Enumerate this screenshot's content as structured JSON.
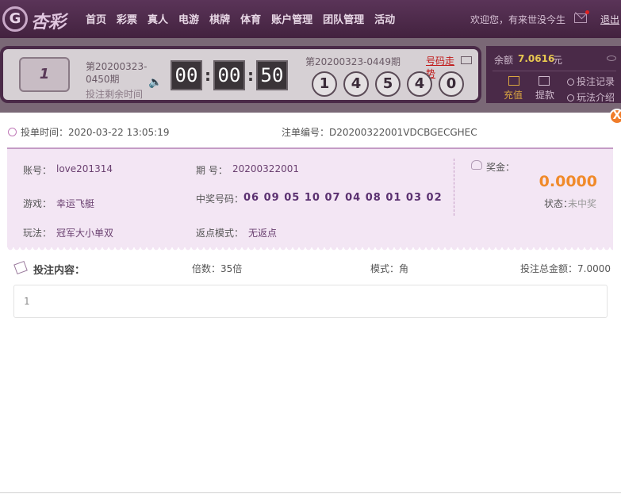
{
  "header": {
    "logo_mark": "G",
    "logo_text": "杏彩",
    "nav": [
      "首页",
      "彩票",
      "真人",
      "电游",
      "棋牌",
      "体育",
      "账户管理",
      "团队管理",
      "活动"
    ],
    "welcome": "欢迎您，有来世没今生",
    "logout": "退出"
  },
  "lottery": {
    "logo_text": "1",
    "current_issue": "第20200323-0450期",
    "remain_label": "投注剩余时间",
    "timer": [
      "00",
      "00",
      "50"
    ],
    "last_issue": "第20200323-0449期",
    "trend_link": "号码走势",
    "balls": [
      "1",
      "4",
      "5",
      "4",
      "0"
    ]
  },
  "account": {
    "balance_label": "余额",
    "balance_value": "7.0616",
    "balance_unit": "元",
    "recharge": "充值",
    "withdraw": "提款",
    "bet_record": "投注记录",
    "play_intro": "玩法介绍"
  },
  "modal": {
    "close": "X",
    "bet_time_label": "投单时间：",
    "bet_time": "2020-03-22 13:05:19",
    "order_no_label": "注单编号：",
    "order_no": "D20200322001VDCBGECGHEC",
    "account_label": "账号：",
    "account": "love201314",
    "issue_label": "期 号：",
    "issue": "20200322001",
    "game_label": "游戏：",
    "game": "幸运飞艇",
    "winning_label": "中奖号码：",
    "winning_numbers": "06 09 05 10 07 04 08 01 03 02",
    "play_label": "玩法：",
    "play": "冠军大小单双",
    "rebate_label": "返点模式：",
    "rebate": "无返点",
    "prize_label": "奖金：",
    "prize_amount": "0.0000",
    "status_label": "状态：",
    "status": "未中奖",
    "content_title": "投注内容：",
    "times": "倍数：35倍",
    "mode": "模式：角",
    "total": "投注总金额：7.0000",
    "content": "1"
  },
  "colors": {
    "header_bg": "#4a2848",
    "info_bg": "#f3e6f4",
    "prize": "#f08a2a",
    "accent_red": "#c01818",
    "close_btn": "#f07c2a"
  }
}
